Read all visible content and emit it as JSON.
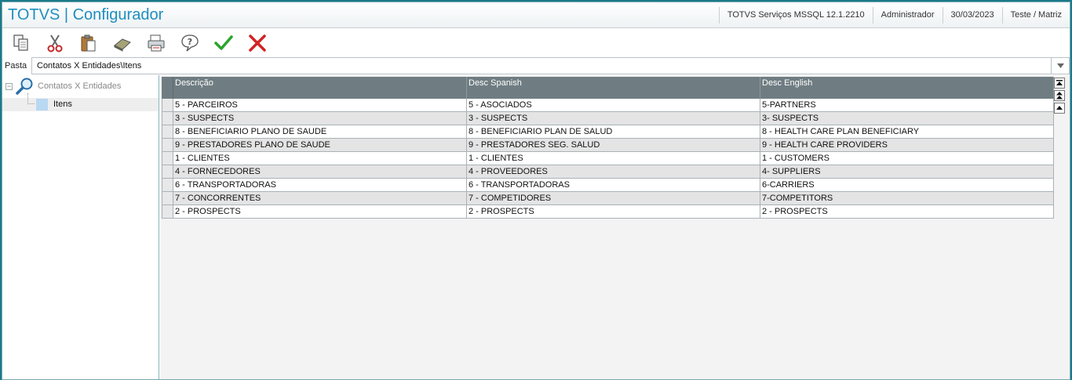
{
  "app": {
    "title": "TOTVS | Configurador",
    "environment": "TOTVS Serviços MSSQL 12.1.2210",
    "user": "Administrador",
    "date": "30/03/2023",
    "company": "Teste / Matriz"
  },
  "toolbar": [
    {
      "icon": "copy-icon"
    },
    {
      "icon": "cut-icon"
    },
    {
      "icon": "paste-icon"
    },
    {
      "icon": "eraser-icon"
    },
    {
      "icon": "print-icon"
    },
    {
      "icon": "help-icon"
    },
    {
      "icon": "confirm-icon",
      "color": "#2aa52a"
    },
    {
      "icon": "cancel-icon",
      "color": "#d22323"
    }
  ],
  "folder": {
    "label": "Pasta",
    "value": "Contatos X Entidades\\Itens"
  },
  "tree": {
    "root_label": "Contatos X Entidades",
    "child_label": "Itens"
  },
  "grid": {
    "columns": [
      "Descrição",
      "Desc Spanish",
      "Desc English"
    ],
    "rows": [
      [
        "5 - PARCEIROS",
        "5 - ASOCIADOS",
        "5-PARTNERS"
      ],
      [
        "3 - SUSPECTS",
        "3 - SUSPECTS",
        "3- SUSPECTS"
      ],
      [
        "8 - BENEFICIARIO PLANO DE SAUDE",
        "8 - BENEFICIARIO PLAN DE SALUD",
        "8 - HEALTH CARE PLAN BENEFICIARY"
      ],
      [
        "9 - PRESTADORES PLANO DE SAUDE",
        "9 - PRESTADORES SEG. SALUD",
        "9 - HEALTH CARE PROVIDERS"
      ],
      [
        "1 - CLIENTES",
        "1 - CLIENTES",
        "1 - CUSTOMERS"
      ],
      [
        "4 - FORNECEDORES",
        "4 - PROVEEDORES",
        "4- SUPPLIERS"
      ],
      [
        "6 - TRANSPORTADORAS",
        "6 - TRANSPORTADORAS",
        "6-CARRIERS"
      ],
      [
        "7 - CONCORRENTES",
        "7 - COMPETIDORES",
        "7-COMPETITORS"
      ],
      [
        "2 - PROSPECTS",
        "2 - PROSPECTS",
        "2 - PROSPECTS"
      ]
    ]
  },
  "colors": {
    "title_text": "#1f8fc0",
    "grid_header": "#6f7d82",
    "frame_border": "#1a7a8a"
  }
}
